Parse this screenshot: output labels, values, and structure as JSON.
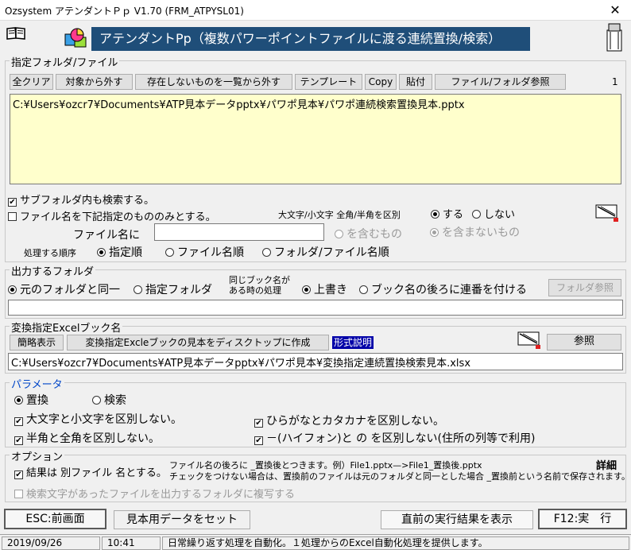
{
  "window": {
    "title": "Ozsystem アテンダントＰｐ V1.70 (FRM_ATPYSL01)",
    "close": "✕"
  },
  "banner": "アテンダントPp（複数パワーポイントファイルに渡る連続置換/検索）",
  "files": {
    "label": "指定フォルダ/ファイル",
    "count": "1",
    "buttons": [
      "全クリア",
      "対象から外す",
      "存在しないものを一覧から外す",
      "テンプレート",
      "Copy",
      "貼付",
      "ファイル/フォルダ参照"
    ],
    "list": [
      "C:¥Users¥ozcr7¥Documents¥ATP見本データpptx¥パワポ見本¥パワポ連続検索置換見本.pptx"
    ],
    "subfolder": "サブフォルダ内も検索する。",
    "filename_only": "ファイル名を下記指定のもののみとする。",
    "case_label": "大文字/小文字 全角/半角を区別",
    "case_yes": "する",
    "case_no": "しない",
    "filename_label": "ファイル名に",
    "filename_value": "",
    "contains": "を含むもの",
    "not_contains": "を含まないもの",
    "order_label": "処理する順序",
    "order_options": [
      "指定順",
      "ファイル名順",
      "フォルダ/ファイル名順"
    ]
  },
  "output": {
    "label": "出力するフォルダ",
    "same": "元のフォルダと同一",
    "specified": "指定フォルダ",
    "same_name_1": "同じブック名が",
    "same_name_2": "ある時の処理",
    "overwrite": "上書き",
    "append": "ブック名の後ろに連番を付ける",
    "browse": "フォルダ参照",
    "path": ""
  },
  "excel": {
    "label": "変換指定Excelブック名",
    "btn_simple": "簡略表示",
    "btn_create": "変換指定Excleブックの見本をディスクトップに作成",
    "format": "形式説明",
    "browse": "参照",
    "path": "C:¥Users¥ozcr7¥Documents¥ATP見本データpptx¥パワポ見本¥変換指定連続置換検索見本.xlsx"
  },
  "params": {
    "label": "パラメータ",
    "replace": "置換",
    "search": "検索",
    "case": "大文字と小文字を区別しない。",
    "hira": "ひらがなとカタカナを区別しない。",
    "width": "半角と全角を区別しない。",
    "hyphen": "－(ハイフォン)と の を区別しない(住所の列等で利用)"
  },
  "options": {
    "label": "オプション",
    "separate": "結果は 別ファイル 名とする。",
    "note1": "ファイル名の後ろに _置換後とつきます。例）File1.pptx—>File1_置換後.pptx",
    "note2": "チェックをつけない場合は、置換前のファイルは元のフォルダと同一とした場合 _置換前という名前で保存されます。",
    "detail": "詳細",
    "copy_found": "検索文字があったファイルを出力するフォルダに複写する"
  },
  "bottom": {
    "esc": "ESC:前画面",
    "sample": "見本用データをセット",
    "prev": "直前の実行結果を表示",
    "run": "F12:実　行"
  },
  "status": {
    "date": "2019/09/26",
    "time": "10:41",
    "msg": "日常繰り返す処理を自動化。１処理からのExcel自動化処理を提供します。"
  }
}
